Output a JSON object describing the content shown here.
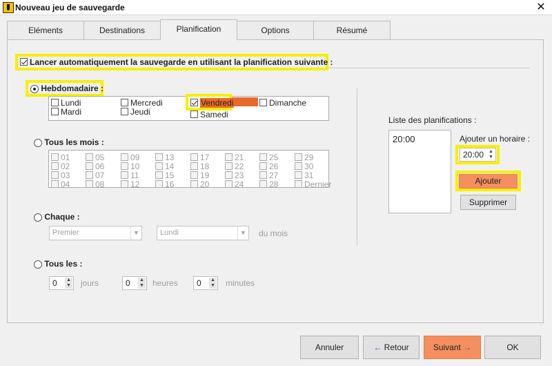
{
  "window": {
    "title": "Nouveau jeu de sauvegarde",
    "close_glyph": "✕"
  },
  "tabs": [
    {
      "label": "Eléments"
    },
    {
      "label": "Destinations"
    },
    {
      "label": "Planification"
    },
    {
      "label": "Options"
    },
    {
      "label": "Résumé"
    }
  ],
  "auto_schedule": {
    "label": "Lancer automatiquement la sauvegarde en utilisant la planification suivante :",
    "checked": true
  },
  "weekly": {
    "label": "Hebdomadaire :",
    "days": [
      {
        "label": "Lundi",
        "checked": false
      },
      {
        "label": "Mercredi",
        "checked": false
      },
      {
        "label": "Vendredi",
        "checked": true
      },
      {
        "label": "Dimanche",
        "checked": false
      },
      {
        "label": "Mardi",
        "checked": false
      },
      {
        "label": "Jeudi",
        "checked": false
      },
      {
        "label": "Samedi",
        "checked": false
      }
    ]
  },
  "monthly": {
    "label": "Tous les mois :",
    "days": [
      "01",
      "05",
      "09",
      "13",
      "17",
      "21",
      "25",
      "29",
      "02",
      "06",
      "10",
      "14",
      "18",
      "22",
      "26",
      "30",
      "03",
      "07",
      "11",
      "15",
      "19",
      "23",
      "27",
      "31",
      "04",
      "08",
      "12",
      "16",
      "20",
      "24",
      "28",
      "Dernier"
    ]
  },
  "each": {
    "label": "Chaque :",
    "ordinal_value": "Premier",
    "weekday_value": "Lundi",
    "suffix": "du mois"
  },
  "every": {
    "label": "Tous les :",
    "days_value": "0",
    "days_unit": "jours",
    "hours_value": "0",
    "hours_unit": "heures",
    "minutes_value": "0",
    "minutes_unit": "minutes"
  },
  "schedules": {
    "title": "Liste des planifications :",
    "items": [
      "20:00"
    ],
    "add_time_label": "Ajouter un horaire :",
    "time_value": "20:00",
    "add_button": "Ajouter",
    "remove_button": "Supprimer"
  },
  "footer": {
    "cancel": "Annuler",
    "back": "Retour",
    "back_icon": "←",
    "next": "Suivant",
    "next_icon": "→",
    "ok": "OK"
  },
  "colors": {
    "accent_orange": "#f58f5f",
    "highlight_yellow": "#f8ef00",
    "selected_day": "#e86a2a"
  }
}
